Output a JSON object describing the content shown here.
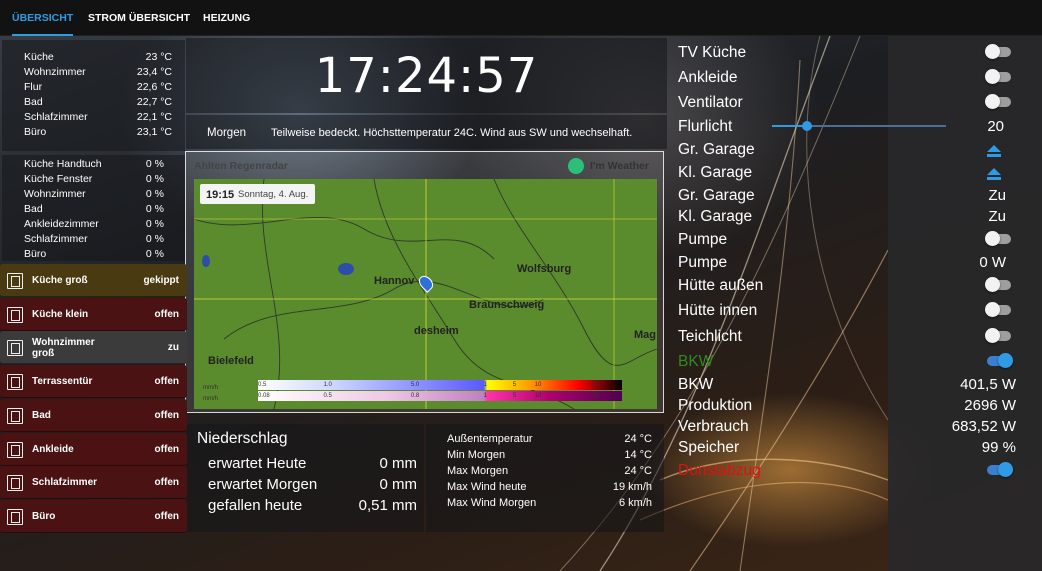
{
  "nav": {
    "tabs": [
      "ÜBERSICHT",
      "STROM ÜBERSICHT",
      "HEIZUNG"
    ],
    "active": 0
  },
  "temperatures": [
    {
      "room": "Küche",
      "value": "23 °C"
    },
    {
      "room": "Wohnzimmer",
      "value": "23,4 °C"
    },
    {
      "room": "Flur",
      "value": "22,6 °C"
    },
    {
      "room": "Bad",
      "value": "22,7 °C"
    },
    {
      "room": "Schlafzimmer",
      "value": "22,1 °C"
    },
    {
      "room": "Büro",
      "value": "23,1 °C"
    }
  ],
  "percentages": [
    {
      "name": "Küche Handtuch",
      "value": "0 %"
    },
    {
      "name": "Küche Fenster",
      "value": "0 %"
    },
    {
      "name": "Wohnzimmer",
      "value": "0 %"
    },
    {
      "name": "Bad",
      "value": "0 %"
    },
    {
      "name": "Ankleidezimmer",
      "value": "0 %"
    },
    {
      "name": "Schlafzimmer",
      "value": "0 %"
    },
    {
      "name": "Büro",
      "value": "0 %"
    }
  ],
  "windows": [
    {
      "name": "Küche groß",
      "state": "gekippt",
      "color": "#4a3a12"
    },
    {
      "name": "Küche klein",
      "state": "offen",
      "color": "#4a1212"
    },
    {
      "name": "Wohnzimmer groß",
      "state": "zu",
      "color": "#3b3b3b"
    },
    {
      "name": "Terrassentür",
      "state": "offen",
      "color": "#4a1212"
    },
    {
      "name": "Bad",
      "state": "offen",
      "color": "#4a1212"
    },
    {
      "name": "Ankleide",
      "state": "offen",
      "color": "#4a1212"
    },
    {
      "name": "Schlafzimmer",
      "state": "offen",
      "color": "#4a1212"
    },
    {
      "name": "Büro",
      "state": "offen",
      "color": "#4a1212"
    }
  ],
  "clock": "17:24:57",
  "forecast": {
    "label": "Morgen",
    "text": "Teilweise bedeckt. Höchsttemperatur 24C. Wind aus SW und wechselhaft."
  },
  "radar": {
    "title": "Ahlten Regenradar",
    "brand": "I'm Weather",
    "time": "19:15",
    "date": "Sonntag, 4. Aug.",
    "cities": [
      "Wolfsburg",
      "Hannov",
      "Braunschweig",
      "desheim",
      "Bielefeld",
      "Mag"
    ],
    "legend_unit": "mm/h",
    "legend_rain": [
      "0.5",
      "1.0",
      "5.0",
      "1",
      "5",
      "10",
      "30"
    ],
    "legend_snow": [
      "0.08",
      "0.5",
      "0.8",
      "1",
      "5",
      "10",
      "30"
    ]
  },
  "precip": {
    "title": "Niederschlag",
    "rows": [
      {
        "label": "erwartet Heute",
        "value": "0 mm"
      },
      {
        "label": "erwartet Morgen",
        "value": "0 mm"
      },
      {
        "label": "gefallen heute",
        "value": "0,51 mm"
      }
    ]
  },
  "weather": [
    {
      "label": "Außentemperatur",
      "value": "24 °C"
    },
    {
      "label": "Min Morgen",
      "value": "14 °C"
    },
    {
      "label": "Max Morgen",
      "value": "24 °C"
    },
    {
      "label": "Max Wind heute",
      "value": "19 km/h"
    },
    {
      "label": "Max Wind Morgen",
      "value": "6 km/h"
    }
  ],
  "controls": [
    {
      "name": "TV Küche",
      "type": "toggle",
      "on": false
    },
    {
      "name": "Ankleide",
      "type": "toggle",
      "on": false
    },
    {
      "name": "Ventilator",
      "type": "toggle",
      "on": false
    },
    {
      "name": "Flurlicht",
      "type": "slider",
      "value": "20",
      "level": 0.2
    },
    {
      "name": "Gr. Garage",
      "type": "cover",
      "icon": "eject-icon"
    },
    {
      "name": "Kl. Garage",
      "type": "cover",
      "icon": "eject-icon"
    },
    {
      "name": "Gr. Garage",
      "type": "text",
      "value": "Zu"
    },
    {
      "name": "Kl. Garage",
      "type": "text",
      "value": "Zu"
    },
    {
      "name": "Pumpe",
      "type": "toggle",
      "on": false
    },
    {
      "name": "Pumpe",
      "type": "text",
      "value": "0 W"
    },
    {
      "name": "Hütte außen",
      "type": "toggle",
      "on": false
    },
    {
      "name": "Hütte innen",
      "type": "toggle",
      "on": false
    },
    {
      "name": "Teichlicht",
      "type": "toggle",
      "on": false
    },
    {
      "name": "BKW",
      "type": "toggle",
      "on": true,
      "color": "#2e8b1e"
    }
  ],
  "power": [
    {
      "label": "BKW",
      "value": "401,5 W"
    },
    {
      "label": "Produktion",
      "value": "2696 W"
    },
    {
      "label": "Verbrauch",
      "value": "683,52 W"
    },
    {
      "label": "Speicher",
      "value": "99 %"
    }
  ],
  "dunstabzug": {
    "label": "Dunstabzug",
    "on": true,
    "color": "#e01010"
  },
  "colors": {
    "accent": "#2f9be4",
    "open": "#4a1212",
    "tilted": "#4a3a12",
    "closed": "#3b3b3b"
  }
}
